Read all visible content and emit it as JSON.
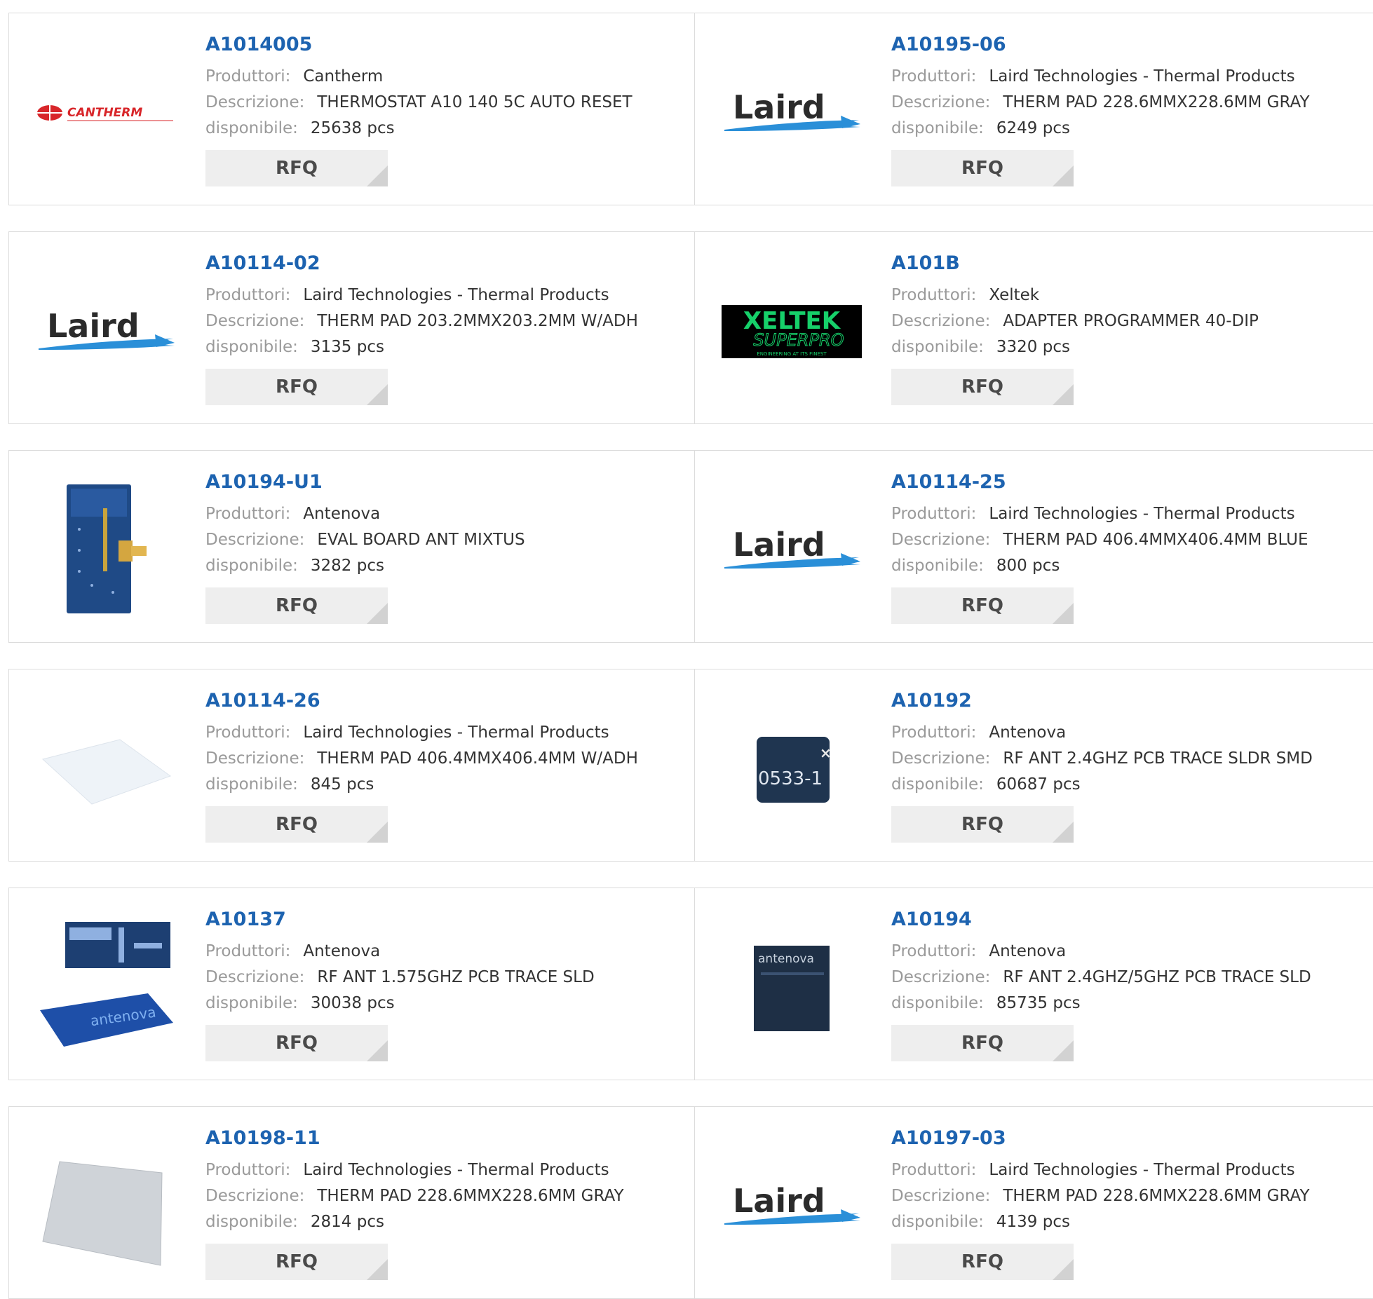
{
  "labels": {
    "manufacturer": "Produttori:",
    "description": "Descrizione:",
    "available": "disponibile:",
    "rfq": "RFQ"
  },
  "logo_text": {
    "cantherm": "CANTHERM",
    "laird": "Laird",
    "xeltek_top": "XELTEK",
    "xeltek_bottom": "SUPERPRO",
    "xeltek_tagline": "ENGINEERING AT ITS FINEST",
    "antenova": "antenova",
    "chip_code": "0533-1"
  },
  "products": [
    {
      "part": "A1014005",
      "manufacturer": "Cantherm",
      "description": "THERMOSTAT A10 140 5C AUTO RESET",
      "available": "25638 pcs",
      "image": "cantherm-logo"
    },
    {
      "part": "A10195-06",
      "manufacturer": "Laird Technologies - Thermal Products",
      "description": "THERM PAD 228.6MMX228.6MM GRAY",
      "available": "6249 pcs",
      "image": "laird-logo"
    },
    {
      "part": "A10114-02",
      "manufacturer": "Laird Technologies - Thermal Products",
      "description": "THERM PAD 203.2MMX203.2MM W/ADH",
      "available": "3135 pcs",
      "image": "laird-logo"
    },
    {
      "part": "A101B",
      "manufacturer": "Xeltek",
      "description": "ADAPTER PROGRAMMER 40-DIP",
      "available": "3320 pcs",
      "image": "xeltek-logo"
    },
    {
      "part": "A10194-U1",
      "manufacturer": "Antenova",
      "description": "EVAL BOARD ANT MIXTUS",
      "available": "3282 pcs",
      "image": "eval-board-photo"
    },
    {
      "part": "A10114-25",
      "manufacturer": "Laird Technologies - Thermal Products",
      "description": "THERM PAD 406.4MMX406.4MM BLUE",
      "available": "800 pcs",
      "image": "laird-logo"
    },
    {
      "part": "A10114-26",
      "manufacturer": "Laird Technologies - Thermal Products",
      "description": "THERM PAD 406.4MMX406.4MM W/ADH",
      "available": "845 pcs",
      "image": "white-pad-photo"
    },
    {
      "part": "A10192",
      "manufacturer": "Antenova",
      "description": "RF ANT 2.4GHZ PCB TRACE SLDR SMD",
      "available": "60687 pcs",
      "image": "chip-antenna-photo"
    },
    {
      "part": "A10137",
      "manufacturer": "Antenova",
      "description": "RF ANT 1.575GHZ PCB TRACE SLD",
      "available": "30038 pcs",
      "image": "antenova-strip-photo"
    },
    {
      "part": "A10194",
      "manufacturer": "Antenova",
      "description": "RF ANT 2.4GHZ/5GHZ PCB TRACE SLD",
      "available": "85735 pcs",
      "image": "antenova-square-photo"
    },
    {
      "part": "A10198-11",
      "manufacturer": "Laird Technologies - Thermal Products",
      "description": "THERM PAD 228.6MMX228.6MM GRAY",
      "available": "2814 pcs",
      "image": "gray-pad-photo"
    },
    {
      "part": "A10197-03",
      "manufacturer": "Laird Technologies - Thermal Products",
      "description": "THERM PAD 228.6MMX228.6MM GRAY",
      "available": "4139 pcs",
      "image": "laird-logo"
    }
  ]
}
